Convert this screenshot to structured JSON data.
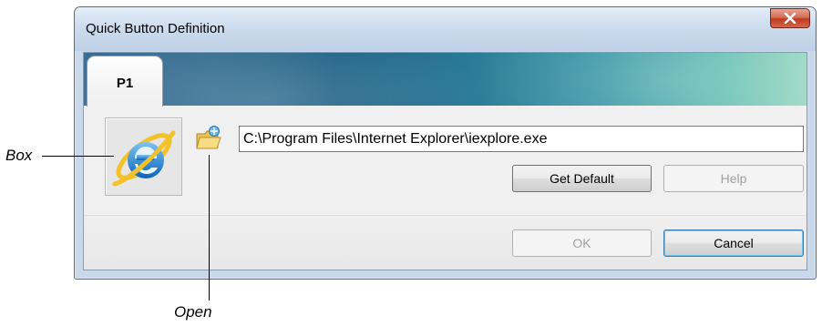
{
  "dialog": {
    "title": "Quick Button Definition",
    "close_icon": "close-x-icon",
    "tabs": [
      {
        "label": "P1",
        "selected": true
      }
    ],
    "program_icon": "internet-explorer-icon",
    "open_icon": "open-folder-icon",
    "path_field": {
      "value": "C:\\Program Files\\Internet Explorer\\iexplore.exe"
    },
    "buttons": {
      "get_default": "Get Default",
      "help": "Help",
      "ok": "OK",
      "cancel": "Cancel"
    },
    "button_states": {
      "help_enabled": false,
      "ok_enabled": false,
      "cancel_focused": true
    }
  },
  "annotations": {
    "box_label": "Box",
    "open_label": "Open"
  },
  "colors": {
    "title_bar": "#cddcee",
    "close_button": "#c13a1f",
    "tab_banner_start": "#3e6b92",
    "tab_banner_end": "#9fd9c4",
    "client_background": "#f0f0f0"
  }
}
